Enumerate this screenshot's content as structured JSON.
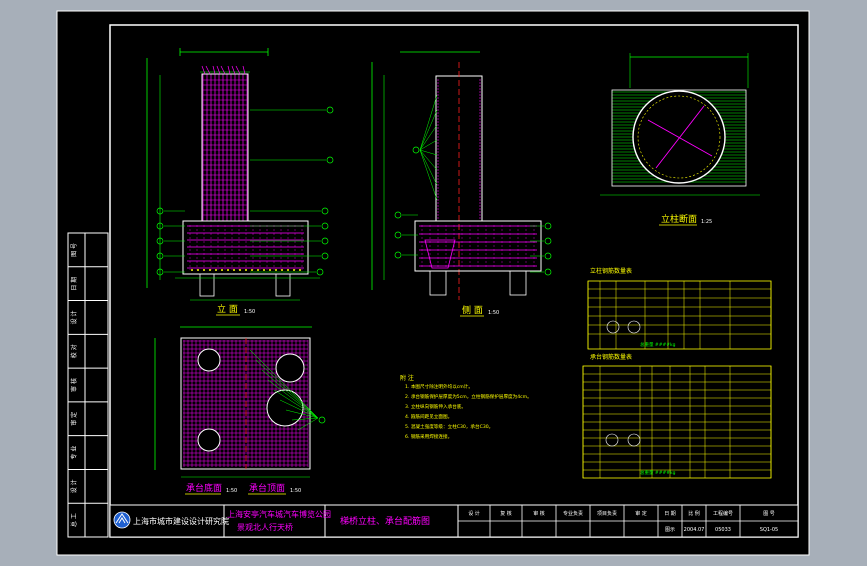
{
  "colors": {
    "background": "#000000",
    "frame": "#ffffff",
    "rebar": "#ff00ff",
    "dims": "#00ff00",
    "concrete": "#ffffff",
    "title_text": "#ffff00",
    "cyan": "#00ffff",
    "red": "#ff2020"
  },
  "views": {
    "elevation": "立 面",
    "elevation_scale": "1:50",
    "side": "侧 面",
    "side_scale": "1:50",
    "column_section": "立柱断面",
    "column_section_scale": "1:25",
    "pile_cap_bottom": "承台底面",
    "pile_cap_bottom_scale": "1:50",
    "pile_cap_top": "承台顶面",
    "pile_cap_top_scale": "1:50"
  },
  "tables": {
    "column_title": "立柱钢筋数量表",
    "cap_title": "承台钢筋数量表",
    "column_total": "总重量 ####kg",
    "cap_total": "总重量 ####kg"
  },
  "notes": {
    "heading": "附 注",
    "lines": [
      "1. 本图尺寸除注明外均以cm计。",
      "2. 承台钢筋保护层厚度为5cm，立柱钢筋保护层厚度为4cm。",
      "3. 立柱纵向钢筋伸入承台底。",
      "4. 箍筋间距见立面图。",
      "5. 混凝土强度等级：立柱C30，承台C30。",
      "6. 钢筋采用焊接连接。"
    ]
  },
  "title_block": {
    "institute": "上海市城市建设设计研究院",
    "project_line1": "上海安亭汽车城汽车博览公园",
    "project_line2": "景观北人行天桥",
    "drawing_title": "梯桥立柱、承台配筋图",
    "header_cells": [
      "设 计",
      "复 核",
      "审 核",
      "专业负责",
      "项目负责",
      "审 定",
      "日 期",
      "比 例",
      "工程编号",
      "图 号"
    ],
    "values": [
      "图示",
      "2004.07",
      "05033",
      "SQ1-05"
    ]
  },
  "revision_strip": [
    "图 号",
    "日 期",
    "设 计",
    "校 对",
    "审 核",
    "审 定",
    "专 业",
    "设 计",
    "总 工"
  ]
}
